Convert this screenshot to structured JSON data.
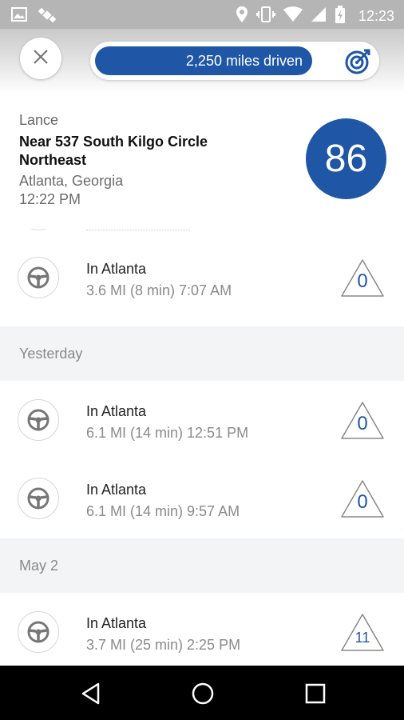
{
  "status_bar": {
    "time": "12:23",
    "left_icons": [
      "image-icon",
      "satellite-icon"
    ],
    "right_icons": [
      "location-pin-icon",
      "vibrate-icon",
      "wifi-icon",
      "signal-icon",
      "battery-charging-icon"
    ]
  },
  "header": {
    "miles_driven": "2,250 miles driven"
  },
  "location": {
    "name": "Lance",
    "address": "Near 537 South Kilgo Circle Northeast",
    "city": "Atlanta, Georgia",
    "time": "12:22 PM",
    "score": "86"
  },
  "trips_today": [
    {
      "title": "In Atlanta",
      "detail": "3.6 MI (8 min) 7:07 AM",
      "events": "0"
    }
  ],
  "sections": {
    "yesterday": "Yesterday",
    "may2": "May 2"
  },
  "trips_yesterday": [
    {
      "title": "In Atlanta",
      "detail": "6.1 MI (14 min) 12:51 PM",
      "events": "0"
    },
    {
      "title": "In Atlanta",
      "detail": "6.1 MI (14 min) 9:57 AM",
      "events": "0"
    }
  ],
  "trips_may2": [
    {
      "title": "In Atlanta",
      "detail": "3.7 MI (25 min) 2:25 PM",
      "events": "11"
    }
  ],
  "colors": {
    "brand_blue": "#1f56a6",
    "section_bg": "#f3f4f6"
  }
}
